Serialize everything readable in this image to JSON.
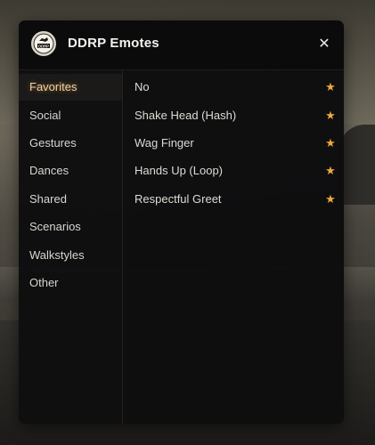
{
  "window": {
    "title": "DDRP Emotes",
    "logo_text": "DDRP",
    "close_glyph": "✕"
  },
  "sidebar": {
    "items": [
      {
        "label": "Favorites",
        "active": true
      },
      {
        "label": "Social",
        "active": false
      },
      {
        "label": "Gestures",
        "active": false
      },
      {
        "label": "Dances",
        "active": false
      },
      {
        "label": "Shared",
        "active": false
      },
      {
        "label": "Scenarios",
        "active": false
      },
      {
        "label": "Walkstyles",
        "active": false
      },
      {
        "label": "Other",
        "active": false
      }
    ]
  },
  "emotes": {
    "items": [
      {
        "label": "No",
        "favorite": true
      },
      {
        "label": "Shake Head (Hash)",
        "favorite": true
      },
      {
        "label": "Wag Finger",
        "favorite": true
      },
      {
        "label": "Hands Up (Loop)",
        "favorite": true
      },
      {
        "label": "Respectful Greet",
        "favorite": true
      }
    ],
    "star_glyph": "★"
  },
  "colors": {
    "accent": "#f0a93c",
    "active_text": "#f0d2a2",
    "panel_bg": "#0e0e0f"
  }
}
